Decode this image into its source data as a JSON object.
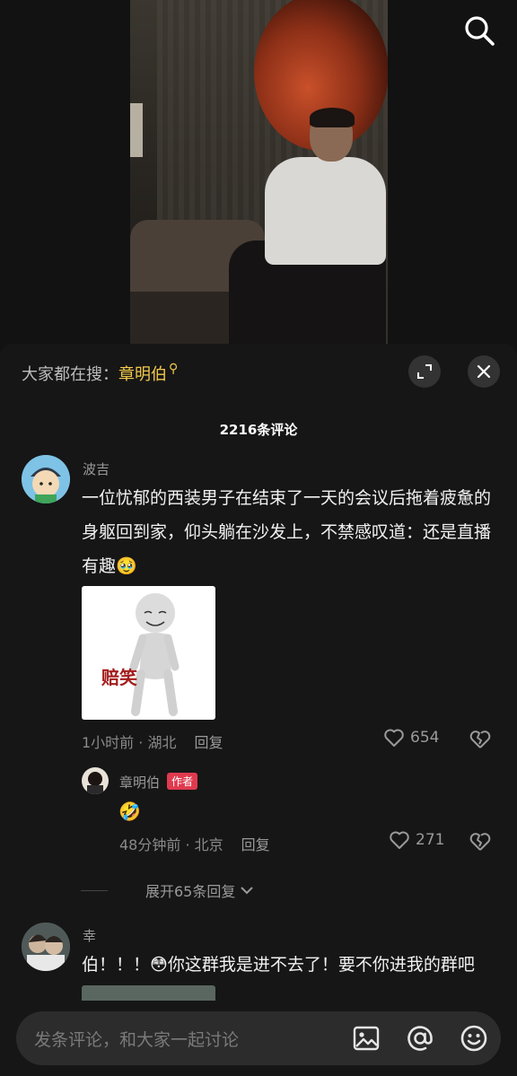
{
  "trending": {
    "label": "大家都在搜：",
    "keyword": "章明伯"
  },
  "comments_header": {
    "count_label": "2216条评论"
  },
  "comments": [
    {
      "username": "波吉",
      "text_line1": "一位忧郁的西装男子在结束了一天的会议后拖着疲惫的",
      "text_line2": "身躯回到家，仰头躺在沙发上，不禁感叹道：还是直播",
      "text_line3": "有趣",
      "text_emoji": "🥹",
      "sticker_text": "赔笑",
      "meta": "1小时前 · 湖北",
      "reply_label": "回复",
      "likes": "654"
    },
    {
      "username": "幸",
      "text": "伯！！！",
      "text_emoji": "😳",
      "text_after": "你这群我是进不去了！要不你进我的群吧"
    }
  ],
  "reply": {
    "username": "章明伯",
    "badge": "作者",
    "text": "🤣",
    "meta": "48分钟前 · 北京",
    "reply_label": "回复",
    "likes": "271"
  },
  "expand_replies": "展开65条回复",
  "input": {
    "placeholder": "发条评论，和大家一起讨论"
  },
  "icons": {
    "search": "search-icon",
    "expand": "expand-icon",
    "close": "close-icon",
    "heart": "heart-icon",
    "broken_heart": "broken-heart-icon",
    "image": "image-icon",
    "at": "at-icon",
    "emoji": "emoji-icon",
    "chevron": "chevron-down-icon"
  },
  "colors": {
    "accent_yellow": "#f2c94c",
    "author_badge": "#e03a4f",
    "background": "#161616"
  }
}
